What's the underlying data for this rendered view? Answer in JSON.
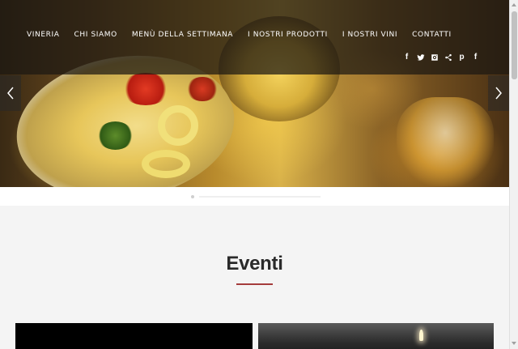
{
  "nav": {
    "items": [
      {
        "label": "VINERIA"
      },
      {
        "label": "CHI SIAMO"
      },
      {
        "label": "MENÙ DELLA SETTIMANA"
      },
      {
        "label": "I NOSTRI PRODOTTI"
      },
      {
        "label": "I NOSTRI VINI"
      },
      {
        "label": "CONTATTI"
      }
    ]
  },
  "social": {
    "items": [
      {
        "icon": "facebook-icon",
        "glyph": "f"
      },
      {
        "icon": "twitter-icon",
        "glyph": ""
      },
      {
        "icon": "instagram-icon",
        "glyph": ""
      },
      {
        "icon": "share-icon",
        "glyph": ""
      },
      {
        "icon": "pinterest-icon",
        "glyph": "p"
      },
      {
        "icon": "facebook-icon",
        "glyph": "f"
      }
    ]
  },
  "events": {
    "title": "Eventi",
    "accent_color": "#a43c3c"
  }
}
